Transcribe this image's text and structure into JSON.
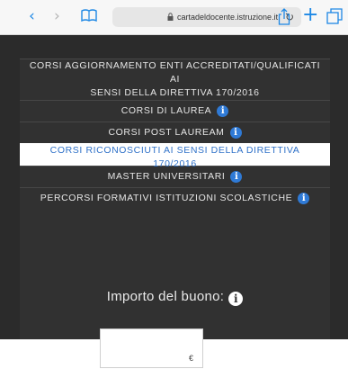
{
  "browser": {
    "url": "cartadeldocente.istruzione.it",
    "back_glyph": "‹",
    "forward_glyph": "›",
    "reload_glyph": "↻",
    "plus_glyph": "+"
  },
  "menu": {
    "items": [
      {
        "label": "CORSI AGGIORNAMENTO ENTI ACCREDITATI/QUALIFICATI AI\nSENSI DELLA DIRETTIVA 170/2016",
        "info": false,
        "selected": false
      },
      {
        "label": "CORSI DI LAUREA",
        "info": true,
        "selected": false
      },
      {
        "label": "CORSI POST LAUREAM",
        "info": true,
        "selected": false
      },
      {
        "label": "CORSI RICONOSCIUTI AI SENSI DELLA DIRETTIVA 170/2016",
        "info": false,
        "selected": true
      },
      {
        "label": "MASTER UNIVERSITARI",
        "info": true,
        "selected": false
      },
      {
        "label": "PERCORSI FORMATIVI ISTITUZIONI SCOLASTICHE",
        "info": true,
        "selected": false
      }
    ],
    "info_glyph": "i"
  },
  "importo": {
    "label": "Importo del buono:",
    "info_glyph": "i",
    "currency": "€",
    "value": ""
  },
  "colors": {
    "background": "#2b2b2b",
    "panel": "#313131",
    "accent_blue": "#2f7ad6",
    "selected_text": "#2f71c8"
  }
}
